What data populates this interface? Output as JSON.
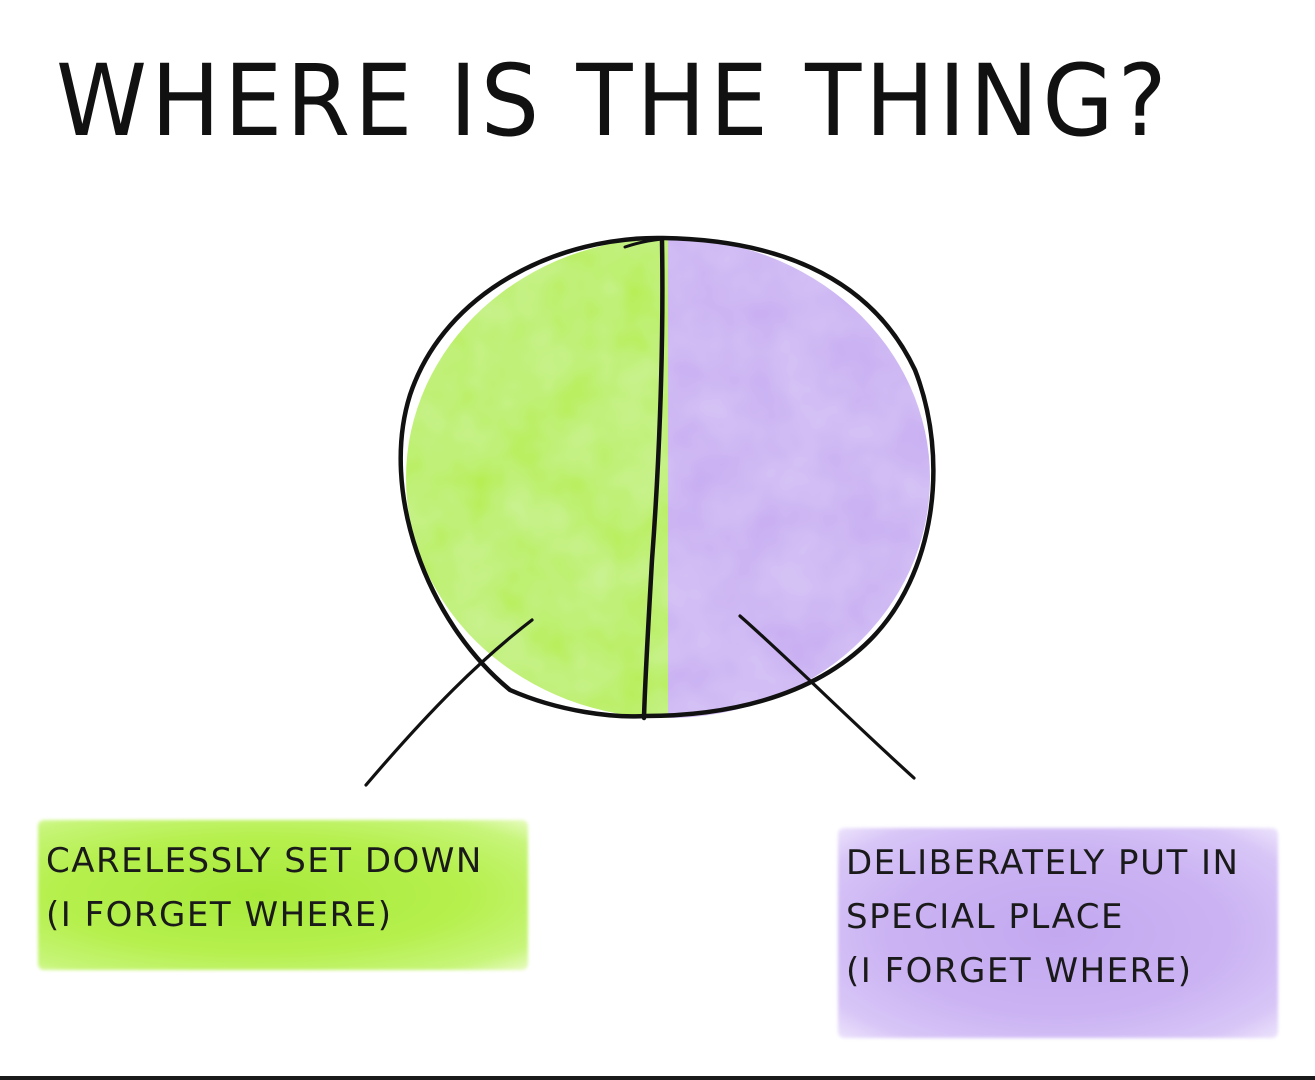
{
  "title": "WHERE IS THE THING?",
  "chart_data": {
    "type": "pie",
    "title": "WHERE IS THE THING?",
    "slices": [
      {
        "label": "CARELESSLY SET DOWN (I FORGET WHERE)",
        "label_lines": [
          "CARELESSLY SET DOWN",
          "(I FORGET WHERE)"
        ],
        "value": 50,
        "color": "#b4ee45"
      },
      {
        "label": "DELIBERATELY PUT IN SPECIAL PLACE (I FORGET WHERE)",
        "label_lines": [
          "DELIBERATELY PUT IN",
          "SPECIAL PLACE",
          "(I FORGET WHERE)"
        ],
        "value": 50,
        "color": "#c6aaf2"
      }
    ],
    "legend": "none",
    "label_placement": "below, with leader lines"
  }
}
